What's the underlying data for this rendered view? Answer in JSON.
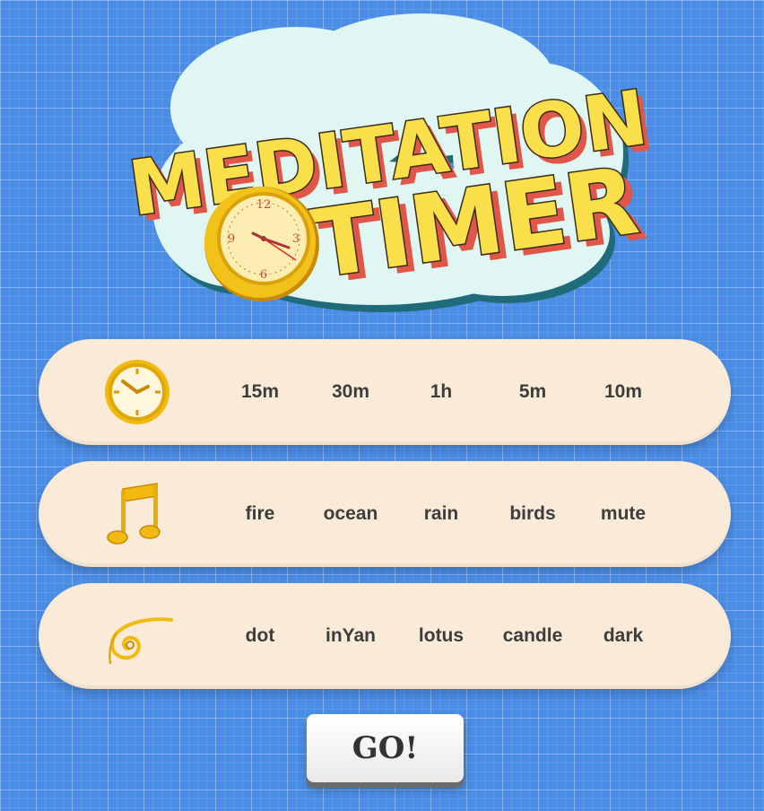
{
  "title": {
    "line1": "MEDITATION",
    "line2": "TIMER"
  },
  "rows": [
    {
      "icon": "clock-icon",
      "options": [
        "15m",
        "30m",
        "1h",
        "5m",
        "10m"
      ]
    },
    {
      "icon": "music-note-icon",
      "options": [
        "fire",
        "ocean",
        "rain",
        "birds",
        "mute"
      ]
    },
    {
      "icon": "spiral-icon",
      "options": [
        "dot",
        "inYan",
        "lotus",
        "candle",
        "dark"
      ]
    }
  ],
  "go_button": {
    "label": "GO!"
  },
  "colors": {
    "background": "#4a8de6",
    "row_bg": "#faebd8",
    "title_fill": "#f9e04a",
    "title_shadow": "#e0574a",
    "cloud": "#dff6f2",
    "gold": "#f2b90e"
  }
}
